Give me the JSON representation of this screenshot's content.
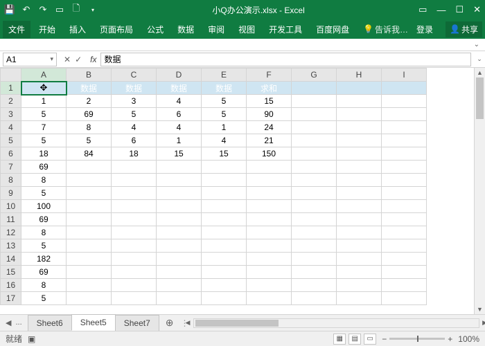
{
  "title": "小Q办公演示.xlsx - Excel",
  "ribbon": {
    "file": "文件",
    "tabs": [
      "开始",
      "插入",
      "页面布局",
      "公式",
      "数据",
      "审阅",
      "视图",
      "开发工具",
      "百度网盘"
    ],
    "tell": "告诉我…",
    "login": "登录",
    "share": "共享"
  },
  "namebox": "A1",
  "formula": "数据",
  "cols": [
    "A",
    "B",
    "C",
    "D",
    "E",
    "F",
    "G",
    "H",
    "I"
  ],
  "rows": [
    "1",
    "2",
    "3",
    "4",
    "5",
    "6",
    "7",
    "8",
    "9",
    "10",
    "11",
    "12",
    "13",
    "14",
    "15",
    "16",
    "17"
  ],
  "header_row": [
    "数据",
    "数据",
    "数据",
    "数据",
    "数据",
    "求和"
  ],
  "data": [
    [
      "1",
      "2",
      "3",
      "4",
      "5",
      "15",
      "",
      "",
      ""
    ],
    [
      "5",
      "69",
      "5",
      "6",
      "5",
      "90",
      "",
      "",
      ""
    ],
    [
      "7",
      "8",
      "4",
      "4",
      "1",
      "24",
      "",
      "",
      ""
    ],
    [
      "5",
      "5",
      "6",
      "1",
      "4",
      "21",
      "",
      "",
      ""
    ],
    [
      "18",
      "84",
      "18",
      "15",
      "15",
      "150",
      "",
      "",
      ""
    ],
    [
      "69",
      "",
      "",
      "",
      "",
      "",
      "",
      "",
      ""
    ],
    [
      "8",
      "",
      "",
      "",
      "",
      "",
      "",
      "",
      ""
    ],
    [
      "5",
      "",
      "",
      "",
      "",
      "",
      "",
      "",
      ""
    ],
    [
      "100",
      "",
      "",
      "",
      "",
      "",
      "",
      "",
      ""
    ],
    [
      "69",
      "",
      "",
      "",
      "",
      "",
      "",
      "",
      ""
    ],
    [
      "8",
      "",
      "",
      "",
      "",
      "",
      "",
      "",
      ""
    ],
    [
      "5",
      "",
      "",
      "",
      "",
      "",
      "",
      "",
      ""
    ],
    [
      "182",
      "",
      "",
      "",
      "",
      "",
      "",
      "",
      ""
    ],
    [
      "69",
      "",
      "",
      "",
      "",
      "",
      "",
      "",
      ""
    ],
    [
      "8",
      "",
      "",
      "",
      "",
      "",
      "",
      "",
      ""
    ],
    [
      "5",
      "",
      "",
      "",
      "",
      "",
      "",
      "",
      ""
    ]
  ],
  "sheets": {
    "dots": "...",
    "list": [
      "Sheet6",
      "Sheet5",
      "Sheet7"
    ],
    "active": "Sheet5"
  },
  "status": {
    "ready": "就绪",
    "rec": "",
    "zoom": "100%",
    "plus": "+"
  }
}
